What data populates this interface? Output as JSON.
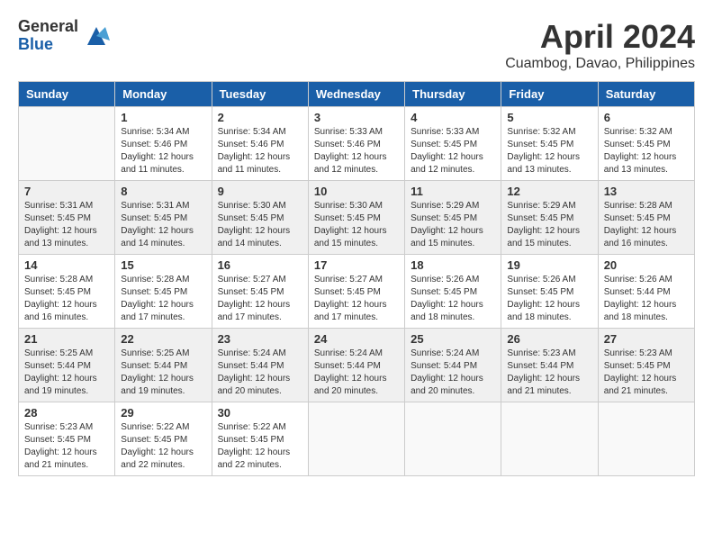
{
  "logo": {
    "general": "General",
    "blue": "Blue"
  },
  "title": "April 2024",
  "subtitle": "Cuambog, Davao, Philippines",
  "weekdays": [
    "Sunday",
    "Monday",
    "Tuesday",
    "Wednesday",
    "Thursday",
    "Friday",
    "Saturday"
  ],
  "weeks": [
    [
      {
        "day": "",
        "info": ""
      },
      {
        "day": "1",
        "info": "Sunrise: 5:34 AM\nSunset: 5:46 PM\nDaylight: 12 hours\nand 11 minutes."
      },
      {
        "day": "2",
        "info": "Sunrise: 5:34 AM\nSunset: 5:46 PM\nDaylight: 12 hours\nand 11 minutes."
      },
      {
        "day": "3",
        "info": "Sunrise: 5:33 AM\nSunset: 5:46 PM\nDaylight: 12 hours\nand 12 minutes."
      },
      {
        "day": "4",
        "info": "Sunrise: 5:33 AM\nSunset: 5:45 PM\nDaylight: 12 hours\nand 12 minutes."
      },
      {
        "day": "5",
        "info": "Sunrise: 5:32 AM\nSunset: 5:45 PM\nDaylight: 12 hours\nand 13 minutes."
      },
      {
        "day": "6",
        "info": "Sunrise: 5:32 AM\nSunset: 5:45 PM\nDaylight: 12 hours\nand 13 minutes."
      }
    ],
    [
      {
        "day": "7",
        "info": "Sunrise: 5:31 AM\nSunset: 5:45 PM\nDaylight: 12 hours\nand 13 minutes."
      },
      {
        "day": "8",
        "info": "Sunrise: 5:31 AM\nSunset: 5:45 PM\nDaylight: 12 hours\nand 14 minutes."
      },
      {
        "day": "9",
        "info": "Sunrise: 5:30 AM\nSunset: 5:45 PM\nDaylight: 12 hours\nand 14 minutes."
      },
      {
        "day": "10",
        "info": "Sunrise: 5:30 AM\nSunset: 5:45 PM\nDaylight: 12 hours\nand 15 minutes."
      },
      {
        "day": "11",
        "info": "Sunrise: 5:29 AM\nSunset: 5:45 PM\nDaylight: 12 hours\nand 15 minutes."
      },
      {
        "day": "12",
        "info": "Sunrise: 5:29 AM\nSunset: 5:45 PM\nDaylight: 12 hours\nand 15 minutes."
      },
      {
        "day": "13",
        "info": "Sunrise: 5:28 AM\nSunset: 5:45 PM\nDaylight: 12 hours\nand 16 minutes."
      }
    ],
    [
      {
        "day": "14",
        "info": "Sunrise: 5:28 AM\nSunset: 5:45 PM\nDaylight: 12 hours\nand 16 minutes."
      },
      {
        "day": "15",
        "info": "Sunrise: 5:28 AM\nSunset: 5:45 PM\nDaylight: 12 hours\nand 17 minutes."
      },
      {
        "day": "16",
        "info": "Sunrise: 5:27 AM\nSunset: 5:45 PM\nDaylight: 12 hours\nand 17 minutes."
      },
      {
        "day": "17",
        "info": "Sunrise: 5:27 AM\nSunset: 5:45 PM\nDaylight: 12 hours\nand 17 minutes."
      },
      {
        "day": "18",
        "info": "Sunrise: 5:26 AM\nSunset: 5:45 PM\nDaylight: 12 hours\nand 18 minutes."
      },
      {
        "day": "19",
        "info": "Sunrise: 5:26 AM\nSunset: 5:45 PM\nDaylight: 12 hours\nand 18 minutes."
      },
      {
        "day": "20",
        "info": "Sunrise: 5:26 AM\nSunset: 5:44 PM\nDaylight: 12 hours\nand 18 minutes."
      }
    ],
    [
      {
        "day": "21",
        "info": "Sunrise: 5:25 AM\nSunset: 5:44 PM\nDaylight: 12 hours\nand 19 minutes."
      },
      {
        "day": "22",
        "info": "Sunrise: 5:25 AM\nSunset: 5:44 PM\nDaylight: 12 hours\nand 19 minutes."
      },
      {
        "day": "23",
        "info": "Sunrise: 5:24 AM\nSunset: 5:44 PM\nDaylight: 12 hours\nand 20 minutes."
      },
      {
        "day": "24",
        "info": "Sunrise: 5:24 AM\nSunset: 5:44 PM\nDaylight: 12 hours\nand 20 minutes."
      },
      {
        "day": "25",
        "info": "Sunrise: 5:24 AM\nSunset: 5:44 PM\nDaylight: 12 hours\nand 20 minutes."
      },
      {
        "day": "26",
        "info": "Sunrise: 5:23 AM\nSunset: 5:44 PM\nDaylight: 12 hours\nand 21 minutes."
      },
      {
        "day": "27",
        "info": "Sunrise: 5:23 AM\nSunset: 5:45 PM\nDaylight: 12 hours\nand 21 minutes."
      }
    ],
    [
      {
        "day": "28",
        "info": "Sunrise: 5:23 AM\nSunset: 5:45 PM\nDaylight: 12 hours\nand 21 minutes."
      },
      {
        "day": "29",
        "info": "Sunrise: 5:22 AM\nSunset: 5:45 PM\nDaylight: 12 hours\nand 22 minutes."
      },
      {
        "day": "30",
        "info": "Sunrise: 5:22 AM\nSunset: 5:45 PM\nDaylight: 12 hours\nand 22 minutes."
      },
      {
        "day": "",
        "info": ""
      },
      {
        "day": "",
        "info": ""
      },
      {
        "day": "",
        "info": ""
      },
      {
        "day": "",
        "info": ""
      }
    ]
  ]
}
